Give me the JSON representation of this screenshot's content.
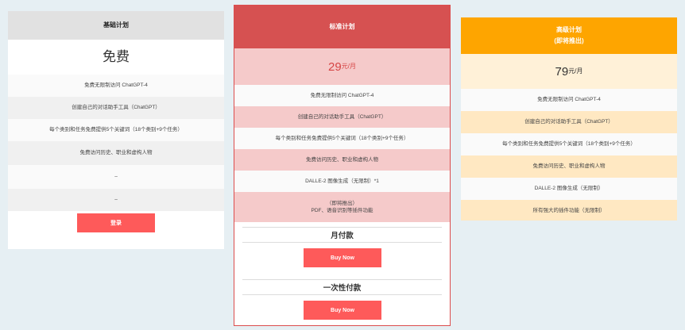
{
  "basic": {
    "title": "基础计划",
    "price": "免费",
    "features": [
      "免费无限制访问 ChatGPT-4",
      "创建自己的对话助手工具（ChatGPT）",
      "每个类别和任务免费提供5个关键词（18个类别+9个任务）",
      "免费访问历史、职业和虚构人物",
      "–",
      "–"
    ],
    "button": "登录"
  },
  "standard": {
    "title": "标准计划",
    "price_amount": "29",
    "price_unit": "元/月",
    "features": [
      "免费无限制访问 ChatGPT-4",
      "创建自己的对话助手工具（ChatGPT）",
      "每个类别和任务免费提供5个关键词（18个类别+9个任务）",
      "免费访问历史、职业和虚构人物",
      "DALLE-2 图像生成（无限制）*1"
    ],
    "coming_soon_line1": "（即将推出）",
    "coming_soon_line2": "PDF、语音识别等插件功能",
    "monthly_title": "月付款",
    "monthly_button": "Buy Now",
    "onetime_title": "一次性付款",
    "onetime_button": "Buy Now"
  },
  "premium": {
    "title": "高级计划",
    "subtitle": "(即将推出)",
    "price_amount": "79",
    "price_unit": "元/月",
    "features": [
      "免费无限制访问 ChatGPT-4",
      "创建自己的对话助手工具（ChatGPT）",
      "每个类别和任务免费提供5个关键词（18个类别+9个任务）",
      "免费访问历史、职业和虚构人物",
      "DALLE-2 图像生成（无限制）",
      "所有强大的插件功能（无限制）"
    ]
  },
  "colors": {
    "standard_accent": "#d65151",
    "premium_accent": "#fea500",
    "button": "#fe5a5a"
  }
}
